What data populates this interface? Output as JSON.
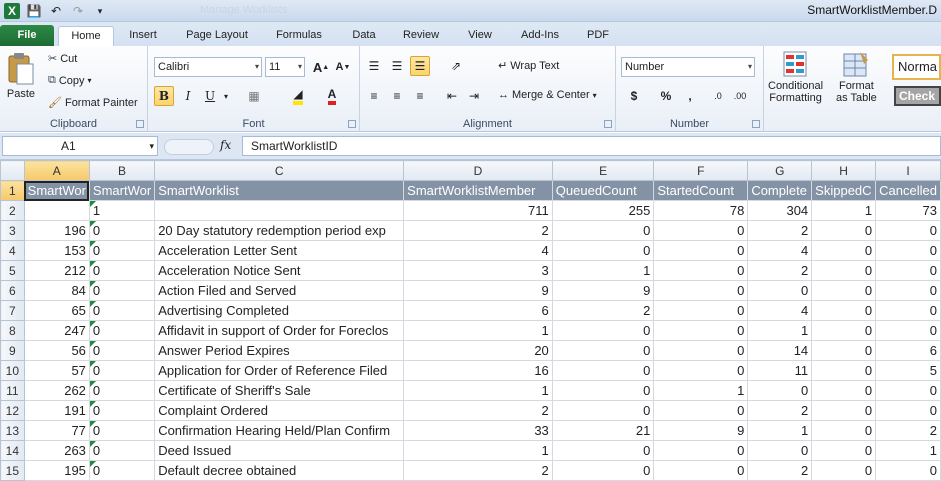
{
  "window": {
    "title": "SmartWorklistMember.D",
    "faded_title": "Manage Worklists"
  },
  "qat": {
    "app_icon": "X"
  },
  "tabs": [
    "File",
    "Home",
    "Insert",
    "Page Layout",
    "Formulas",
    "Data",
    "Review",
    "View",
    "Add-Ins",
    "PDF"
  ],
  "ribbon": {
    "clipboard": {
      "label": "Clipboard",
      "paste": "Paste",
      "cut": "Cut",
      "copy": "Copy",
      "format_painter": "Format Painter"
    },
    "font": {
      "label": "Font",
      "font_name": "Calibri",
      "font_size": "11"
    },
    "alignment": {
      "label": "Alignment",
      "wrap_text": "Wrap Text",
      "merge_center": "Merge & Center"
    },
    "number": {
      "label": "Number",
      "format": "Number",
      "currency": "$",
      "percent": "%",
      "comma": ","
    },
    "styles": {
      "conditional": "Conditional",
      "formatting": "Formatting",
      "format_as": "Format",
      "as_table": "as Table",
      "normal": "Norma",
      "check": "Check C"
    }
  },
  "formula_bar": {
    "name_box": "A1",
    "fx": "fx",
    "value": "SmartWorklistID"
  },
  "sheet": {
    "columns": [
      "A",
      "B",
      "C",
      "D",
      "E",
      "F",
      "G",
      "H",
      "I"
    ],
    "header": [
      "SmartWor",
      "SmartWor",
      "SmartWorklist",
      "SmartWorklistMember",
      "QueuedCount",
      "StartedCount",
      "Complete",
      "SkippedC",
      "Cancelled"
    ],
    "rows": [
      {
        "n": "2",
        "a": "",
        "b": "1",
        "c": "",
        "d": "711",
        "e": "255",
        "f": "78",
        "g": "304",
        "h": "1",
        "i": "73"
      },
      {
        "n": "3",
        "a": "196",
        "b": "0",
        "c": "20 Day statutory redemption period exp",
        "d": "2",
        "e": "0",
        "f": "0",
        "g": "2",
        "h": "0",
        "i": "0"
      },
      {
        "n": "4",
        "a": "153",
        "b": "0",
        "c": "Acceleration Letter Sent",
        "d": "4",
        "e": "0",
        "f": "0",
        "g": "4",
        "h": "0",
        "i": "0"
      },
      {
        "n": "5",
        "a": "212",
        "b": "0",
        "c": "Acceleration Notice Sent",
        "d": "3",
        "e": "1",
        "f": "0",
        "g": "2",
        "h": "0",
        "i": "0"
      },
      {
        "n": "6",
        "a": "84",
        "b": "0",
        "c": "Action Filed and Served",
        "d": "9",
        "e": "9",
        "f": "0",
        "g": "0",
        "h": "0",
        "i": "0"
      },
      {
        "n": "7",
        "a": "65",
        "b": "0",
        "c": "Advertising Completed",
        "d": "6",
        "e": "2",
        "f": "0",
        "g": "4",
        "h": "0",
        "i": "0"
      },
      {
        "n": "8",
        "a": "247",
        "b": "0",
        "c": "Affidavit in support of Order for Foreclos",
        "d": "1",
        "e": "0",
        "f": "0",
        "g": "1",
        "h": "0",
        "i": "0"
      },
      {
        "n": "9",
        "a": "56",
        "b": "0",
        "c": "Answer Period Expires",
        "d": "20",
        "e": "0",
        "f": "0",
        "g": "14",
        "h": "0",
        "i": "6"
      },
      {
        "n": "10",
        "a": "57",
        "b": "0",
        "c": "Application for Order of Reference Filed",
        "d": "16",
        "e": "0",
        "f": "0",
        "g": "11",
        "h": "0",
        "i": "5"
      },
      {
        "n": "11",
        "a": "262",
        "b": "0",
        "c": "Certificate of Sheriff's Sale",
        "d": "1",
        "e": "0",
        "f": "1",
        "g": "0",
        "h": "0",
        "i": "0"
      },
      {
        "n": "12",
        "a": "191",
        "b": "0",
        "c": "Complaint Ordered",
        "d": "2",
        "e": "0",
        "f": "0",
        "g": "2",
        "h": "0",
        "i": "0"
      },
      {
        "n": "13",
        "a": "77",
        "b": "0",
        "c": "Confirmation Hearing Held/Plan Confirm",
        "d": "33",
        "e": "21",
        "f": "9",
        "g": "1",
        "h": "0",
        "i": "2"
      },
      {
        "n": "14",
        "a": "263",
        "b": "0",
        "c": "Deed Issued",
        "d": "1",
        "e": "0",
        "f": "0",
        "g": "0",
        "h": "0",
        "i": "1"
      },
      {
        "n": "15",
        "a": "195",
        "b": "0",
        "c": "Default decree obtained",
        "d": "2",
        "e": "0",
        "f": "0",
        "g": "2",
        "h": "0",
        "i": "0"
      }
    ]
  },
  "colors": {
    "header_fill": "#8492a6",
    "file_tab": "#1e7a3a",
    "selected_header": "#f6c96a"
  }
}
